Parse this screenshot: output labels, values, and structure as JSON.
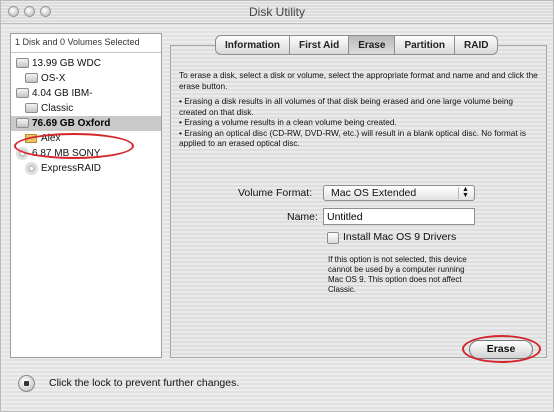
{
  "window": {
    "title": "Disk Utility"
  },
  "sidebar": {
    "header": "1 Disk and 0 Volumes Selected",
    "items": [
      {
        "label": "13.99 GB WDC",
        "level": 0,
        "icon": "hard-disk-icon"
      },
      {
        "label": "OS-X",
        "level": 1,
        "icon": "volume-icon"
      },
      {
        "label": "4.04 GB IBM-",
        "level": 0,
        "icon": "hard-disk-icon"
      },
      {
        "label": "Classic",
        "level": 1,
        "icon": "volume-icon"
      },
      {
        "label": "76.69 GB Oxford",
        "level": 0,
        "icon": "hard-disk-icon",
        "selected": true
      },
      {
        "label": "Alex",
        "level": 1,
        "icon": "volume-icon"
      },
      {
        "label": "6.87 MB SONY",
        "level": 0,
        "icon": "optical-disc-icon"
      },
      {
        "label": "ExpressRAID",
        "level": 1,
        "icon": "optical-disc-icon"
      }
    ]
  },
  "tabs": [
    {
      "label": "Information"
    },
    {
      "label": "First Aid"
    },
    {
      "label": "Erase",
      "active": true
    },
    {
      "label": "Partition"
    },
    {
      "label": "RAID"
    }
  ],
  "erase": {
    "intro": "To erase a disk, select a disk or volume, select the appropriate format and name and and click the erase button.",
    "bullets": [
      "• Erasing a disk results in all volumes of that disk being erased and one large volume being created on that disk.",
      "• Erasing a volume results in a clean volume being created.",
      "• Erasing an optical disc (CD-RW, DVD-RW, etc.) will result in a blank optical disc. No format is applied to an erased optical disc."
    ],
    "volume_format_label": "Volume Format:",
    "volume_format_value": "Mac OS Extended",
    "name_label": "Name:",
    "name_value": "Untitled",
    "install_drivers_label": "Install Mac OS 9 Drivers",
    "note": "If this option is not selected, this device cannot be used by a computer running Mac OS 9.  This option does not affect Classic.",
    "erase_button": "Erase"
  },
  "footer": {
    "lock_text": "Click the lock to prevent further changes."
  },
  "colors": {
    "highlight_circle": "#d3262b"
  }
}
